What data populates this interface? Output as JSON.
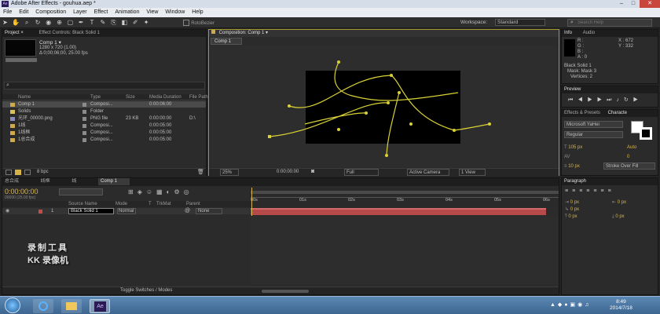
{
  "window": {
    "title": "Adobe After Effects - gouhua.aep *"
  },
  "menu": [
    "File",
    "Edit",
    "Composition",
    "Layer",
    "Effect",
    "Animation",
    "View",
    "Window",
    "Help"
  ],
  "toolbar": {
    "rotobezier_label": "RotoBezier",
    "workspace_label": "Workspace:",
    "workspace_value": "Standard",
    "search_placeholder": "Search Help"
  },
  "project": {
    "tab": "Project ×",
    "effect_controls_tab": "Effect Controls: Black Solid 1",
    "comp_name": "Comp 1 ▾",
    "comp_info1": "1280 x 720 (1.00)",
    "comp_info2": "Δ 0;00;06;00, 25.00 fps",
    "columns": [
      "Name",
      "Type",
      "Size",
      "Media Duration",
      "File Path"
    ],
    "items": [
      {
        "name": "Comp 1",
        "type": "Composi...",
        "size": "",
        "duration": "0:00:06:00",
        "path": "",
        "icon_color": "#cfa94a"
      },
      {
        "name": "Solids",
        "type": "Folder",
        "size": "",
        "duration": "",
        "path": "",
        "icon_color": "#d9c25a"
      },
      {
        "name": "光环_00000.png",
        "type": "PNG file",
        "size": "23 KB",
        "duration": "0:00:00:00",
        "path": "D:\\",
        "icon_color": "#8a8ab8"
      },
      {
        "name": "1线",
        "type": "Composi...",
        "size": "",
        "duration": "0:00:05:00",
        "path": "",
        "icon_color": "#cfa94a"
      },
      {
        "name": "1线框",
        "type": "Composi...",
        "size": "",
        "duration": "0:00:05:00",
        "path": "",
        "icon_color": "#cfa94a"
      },
      {
        "name": "1总合成",
        "type": "Composi...",
        "size": "",
        "duration": "0:00:05:00",
        "path": "",
        "icon_color": "#cfa94a"
      }
    ],
    "bpc": "8 bpc"
  },
  "composition": {
    "tab": "Composition: Comp 1 ▾",
    "subtab": "Comp 1",
    "zoom": "25%",
    "timecode": "0:00:00:00",
    "resolution": "Full",
    "camera": "Active Camera",
    "views": "1 View"
  },
  "info": {
    "tab": "Info",
    "audio_tab": "Audio",
    "r": "R :",
    "g": "G :",
    "b": "B :",
    "a": "A : 0",
    "x": "X : 672",
    "y": "Y : 332",
    "layer": "Black Solid 1",
    "mask": "Mask: Mask 3",
    "vertices": "Vertices: 2"
  },
  "preview": {
    "tab": "Preview"
  },
  "effects": {
    "tab": "Effects & Presets",
    "character_tab": "Characte"
  },
  "character": {
    "font": "Microsoft YaHei",
    "style": "Regular",
    "size": "105 px",
    "leading": "Auto",
    "tracking": "0",
    "stroke": "10 px",
    "stroke_mode": "Stroke Over Fill"
  },
  "paragraph": {
    "tab": "Paragraph",
    "indent1": "0 px",
    "indent2": "0 px",
    "indent3": "0 px",
    "space1": "0 px",
    "space2": "0 px"
  },
  "timeline": {
    "tabs": [
      "总合成",
      "线框",
      "线",
      "Comp 1"
    ],
    "timecode": "0:00:00:00",
    "fps": "00000 (25.00 fps)",
    "columns": [
      "Source Name",
      "Mode",
      "T",
      "TrkMat",
      "Parent"
    ],
    "layer": {
      "num": "1",
      "name": "Black Solid 1",
      "mode": "Normal",
      "parent": "None"
    },
    "ruler": [
      "00s",
      "01s",
      "02s",
      "03s",
      "04s",
      "05s",
      "06s"
    ],
    "toggle_label": "Toggle Switches / Modes"
  },
  "watermark": {
    "line1": "录制工具",
    "line2": "KK 录像机"
  },
  "taskbar": {
    "time": "8:49",
    "date": "2014/7/18"
  },
  "chart_data": null
}
